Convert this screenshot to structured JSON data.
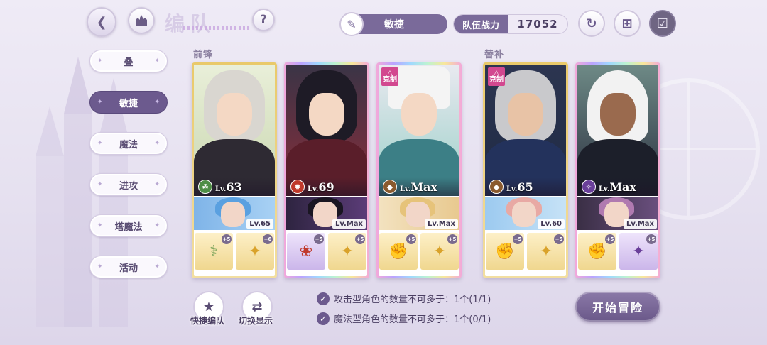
{
  "header": {
    "title": "编队",
    "attribute_label": "敏捷",
    "power_label": "队伍战力",
    "power_value": "17052",
    "help_symbol": "?"
  },
  "tabs": [
    {
      "label": "叠",
      "active": false
    },
    {
      "label": "敏捷",
      "active": true
    },
    {
      "label": "魔法",
      "active": false
    },
    {
      "label": "进攻",
      "active": false
    },
    {
      "label": "塔魔法",
      "active": false
    },
    {
      "label": "活动",
      "active": false
    }
  ],
  "sections": {
    "front": "前锋",
    "sub": "替补"
  },
  "cards": [
    {
      "level_prefix": "Lv.",
      "level": "63",
      "element_icon": "green-leaf-icon",
      "counter": false,
      "support_level": "Lv.65",
      "frame": "gold",
      "equip": [
        {
          "icon": "staff-icon",
          "plus": "+5"
        },
        {
          "icon": "gem-icon",
          "plus": "+6"
        }
      ]
    },
    {
      "level_prefix": "Lv.",
      "level": "69",
      "element_icon": "red-flame-icon",
      "counter": false,
      "support_level": "Lv.Max",
      "frame": "rainbow",
      "equip": [
        {
          "icon": "scepter-icon",
          "plus": "+5"
        },
        {
          "icon": "gem-icon",
          "plus": "+5"
        }
      ]
    },
    {
      "level_prefix": "Lv.",
      "level": "Max",
      "element_icon": "brown-earth-icon",
      "counter": true,
      "counter_label": "克制",
      "support_level": "Lv.Max",
      "frame": "rainbow",
      "equip": [
        {
          "icon": "gauntlet-icon",
          "plus": "+5"
        },
        {
          "icon": "gem-icon",
          "plus": "+5"
        }
      ]
    },
    {
      "level_prefix": "Lv.",
      "level": "65",
      "element_icon": "brown-earth-icon",
      "counter": true,
      "counter_label": "克制",
      "support_level": "Lv.60",
      "frame": "gold",
      "equip": [
        {
          "icon": "gauntlet-icon",
          "plus": "+5"
        },
        {
          "icon": "gem-icon",
          "plus": "+5"
        }
      ]
    },
    {
      "level_prefix": "Lv.",
      "level": "Max",
      "element_icon": "purple-arcane-icon",
      "counter": false,
      "support_level": "Lv.Max",
      "frame": "rainbow",
      "equip": [
        {
          "icon": "gauntlet-icon",
          "plus": "+5"
        },
        {
          "icon": "purple-gem-icon",
          "plus": "+5"
        }
      ]
    }
  ],
  "bottom": {
    "quick_formation": "快捷编队",
    "switch_display": "切换显示",
    "rule1": "攻击型角色的数量不可多于：1个(1/1)",
    "rule2": "魔法型角色的数量不可多于：1个(0/1)",
    "start": "开始冒险"
  },
  "colors": {
    "accent": "#6c5a8e",
    "gold_frame": "#e9c96a",
    "counter_badge": "#d2488f"
  }
}
